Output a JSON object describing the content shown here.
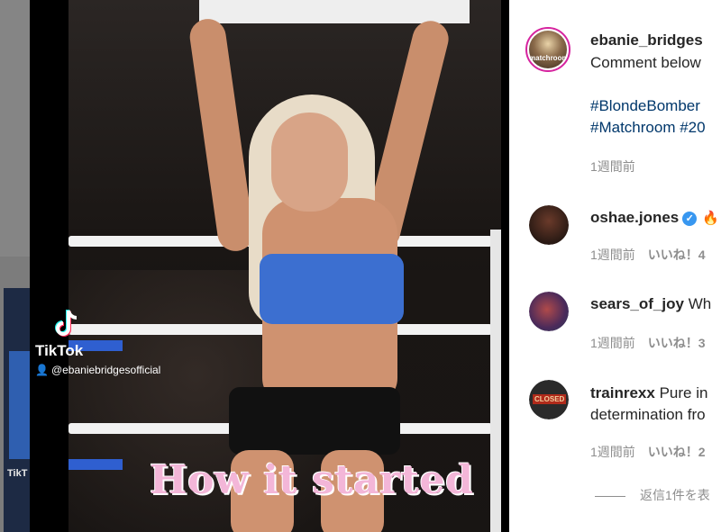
{
  "post": {
    "author": "ebanie_bridges",
    "author_avatar_text": "matchroom",
    "caption_first": "Comment below",
    "hashtag_line1": "#BlondeBomber",
    "hashtag_line2": "#Matchroom #20",
    "time": "1週間前"
  },
  "video": {
    "overlay_text": "How it started",
    "tiktok_label": "TikTok",
    "tiktok_handle": "@ebaniebridgesofficial"
  },
  "comments": [
    {
      "username": "oshae.jones",
      "text": "",
      "verified": true,
      "time": "1週間前",
      "likes": "いいね！4"
    },
    {
      "username": "sears_of_joy",
      "text": "Wh",
      "time": "1週間前",
      "likes": "いいね！3"
    },
    {
      "username": "trainrexx",
      "text": "Pure in",
      "text_line2": "determination fro",
      "avatar_text": "CLOSED",
      "time": "1週間前",
      "likes": "いいね！2"
    }
  ],
  "view_replies": "返信1件を表",
  "background": {
    "tiktok_fragment": "TikT"
  },
  "colors": {
    "link": "#00376b",
    "muted": "#8e8e8e",
    "verified": "#3897f0"
  }
}
